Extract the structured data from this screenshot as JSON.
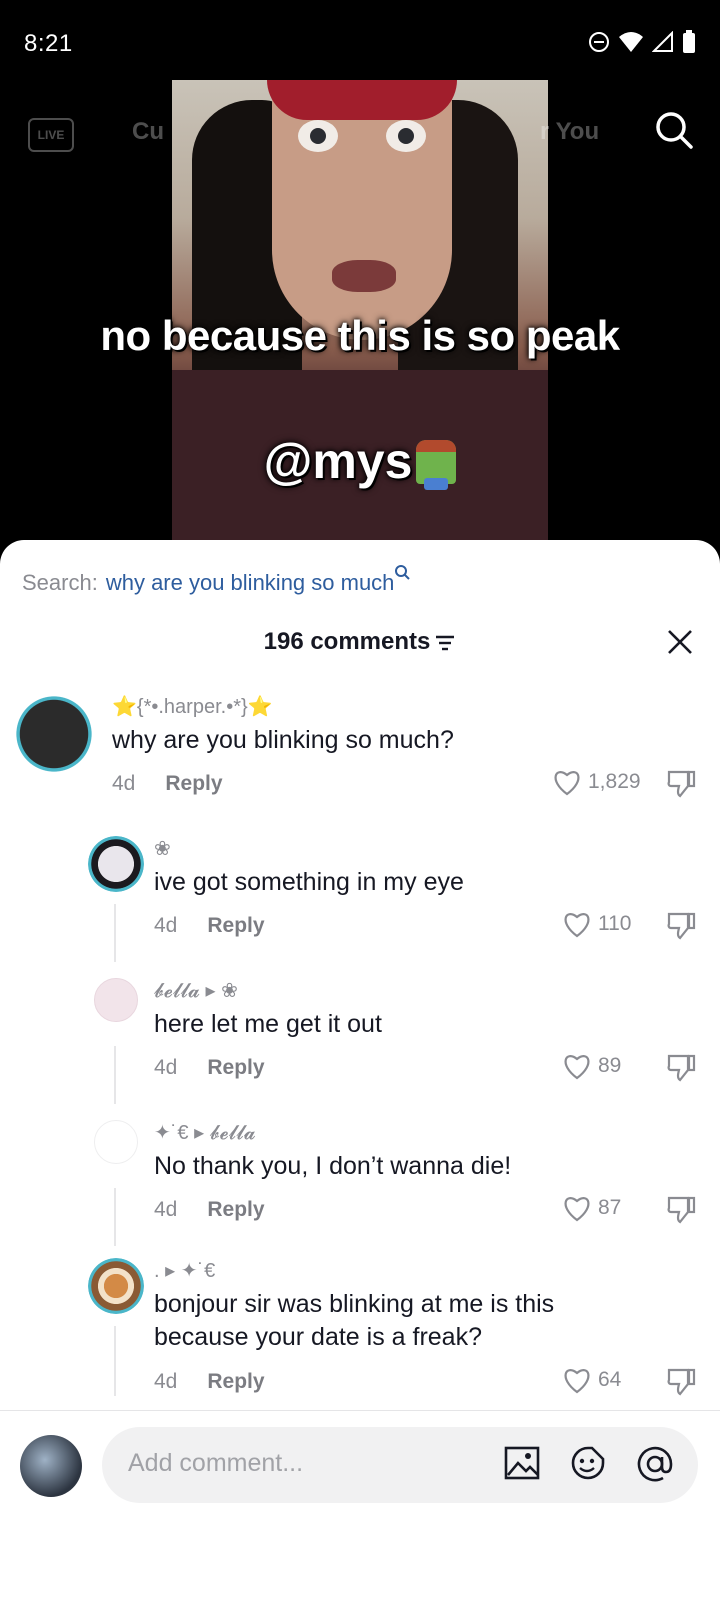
{
  "status_bar": {
    "time": "8:21"
  },
  "video": {
    "caption": "no because this is so peak",
    "mention": "@mys",
    "tabs": {
      "live": "LIVE",
      "left_tab": "Cu",
      "right_tab": "r You"
    }
  },
  "search_suggestion": {
    "label": "Search:",
    "query": "why are you blinking so much"
  },
  "comments_header": {
    "count_label": "196 comments"
  },
  "comments": [
    {
      "user": "⭐{*•.harper.•*}⭐",
      "text": "why are you blinking so much?",
      "age": "4d",
      "reply_label": "Reply",
      "likes": "1,829"
    },
    {
      "user": "❀",
      "text": "ive got something in my eye",
      "age": "4d",
      "reply_label": "Reply",
      "likes": "110"
    },
    {
      "user": "𝓫𝓮𝓵𝓵𝓪 ▸ ❀",
      "text": "here let me get it out",
      "age": "4d",
      "reply_label": "Reply",
      "likes": "89"
    },
    {
      "user": "✦˙€ ▸ 𝓫𝓮𝓵𝓵𝓪",
      "text": "No thank you, I don’t wanna die!",
      "age": "4d",
      "reply_label": "Reply",
      "likes": "87"
    },
    {
      "user": ". ▸ ✦˙€",
      "text": "bonjour sir was blinking at me is this because your date is a freak?",
      "age": "4d",
      "reply_label": "Reply",
      "likes": "64"
    }
  ],
  "input": {
    "placeholder": "Add comment..."
  },
  "icons": {
    "search": "search-icon",
    "close": "close-icon",
    "sort": "sort-icon",
    "heart": "heart-icon",
    "dislike": "dislike-icon",
    "image": "image-icon",
    "emoji": "emoji-icon",
    "mention": "mention-icon"
  }
}
